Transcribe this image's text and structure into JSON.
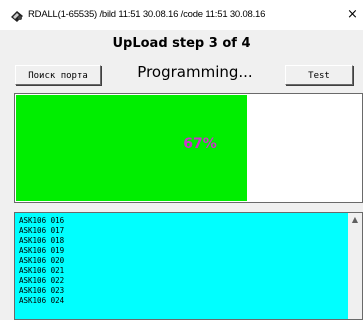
{
  "window": {
    "title": "RDALL(1-65535) /bild 11:51 30.08.16 /code 11:51 30.08.16",
    "close_glyph": "×",
    "icon": "app-icon"
  },
  "header": {
    "title": "UpLoad step 3 of 4"
  },
  "toolbar": {
    "port_label": "Поиск порта",
    "status": "Programming...",
    "test_label": "Test"
  },
  "progress": {
    "percent_label": "67%",
    "fraction": 0.67,
    "fill_color": "#00ee00"
  },
  "log": {
    "lines": [
      "ASK106 016",
      "ASK106 017",
      "ASK106 018",
      "ASK106 019",
      "ASK106 020",
      "ASK106 021",
      "ASK106 022",
      "ASK106 023",
      "ASK106 024"
    ],
    "background": "#00ffff"
  }
}
